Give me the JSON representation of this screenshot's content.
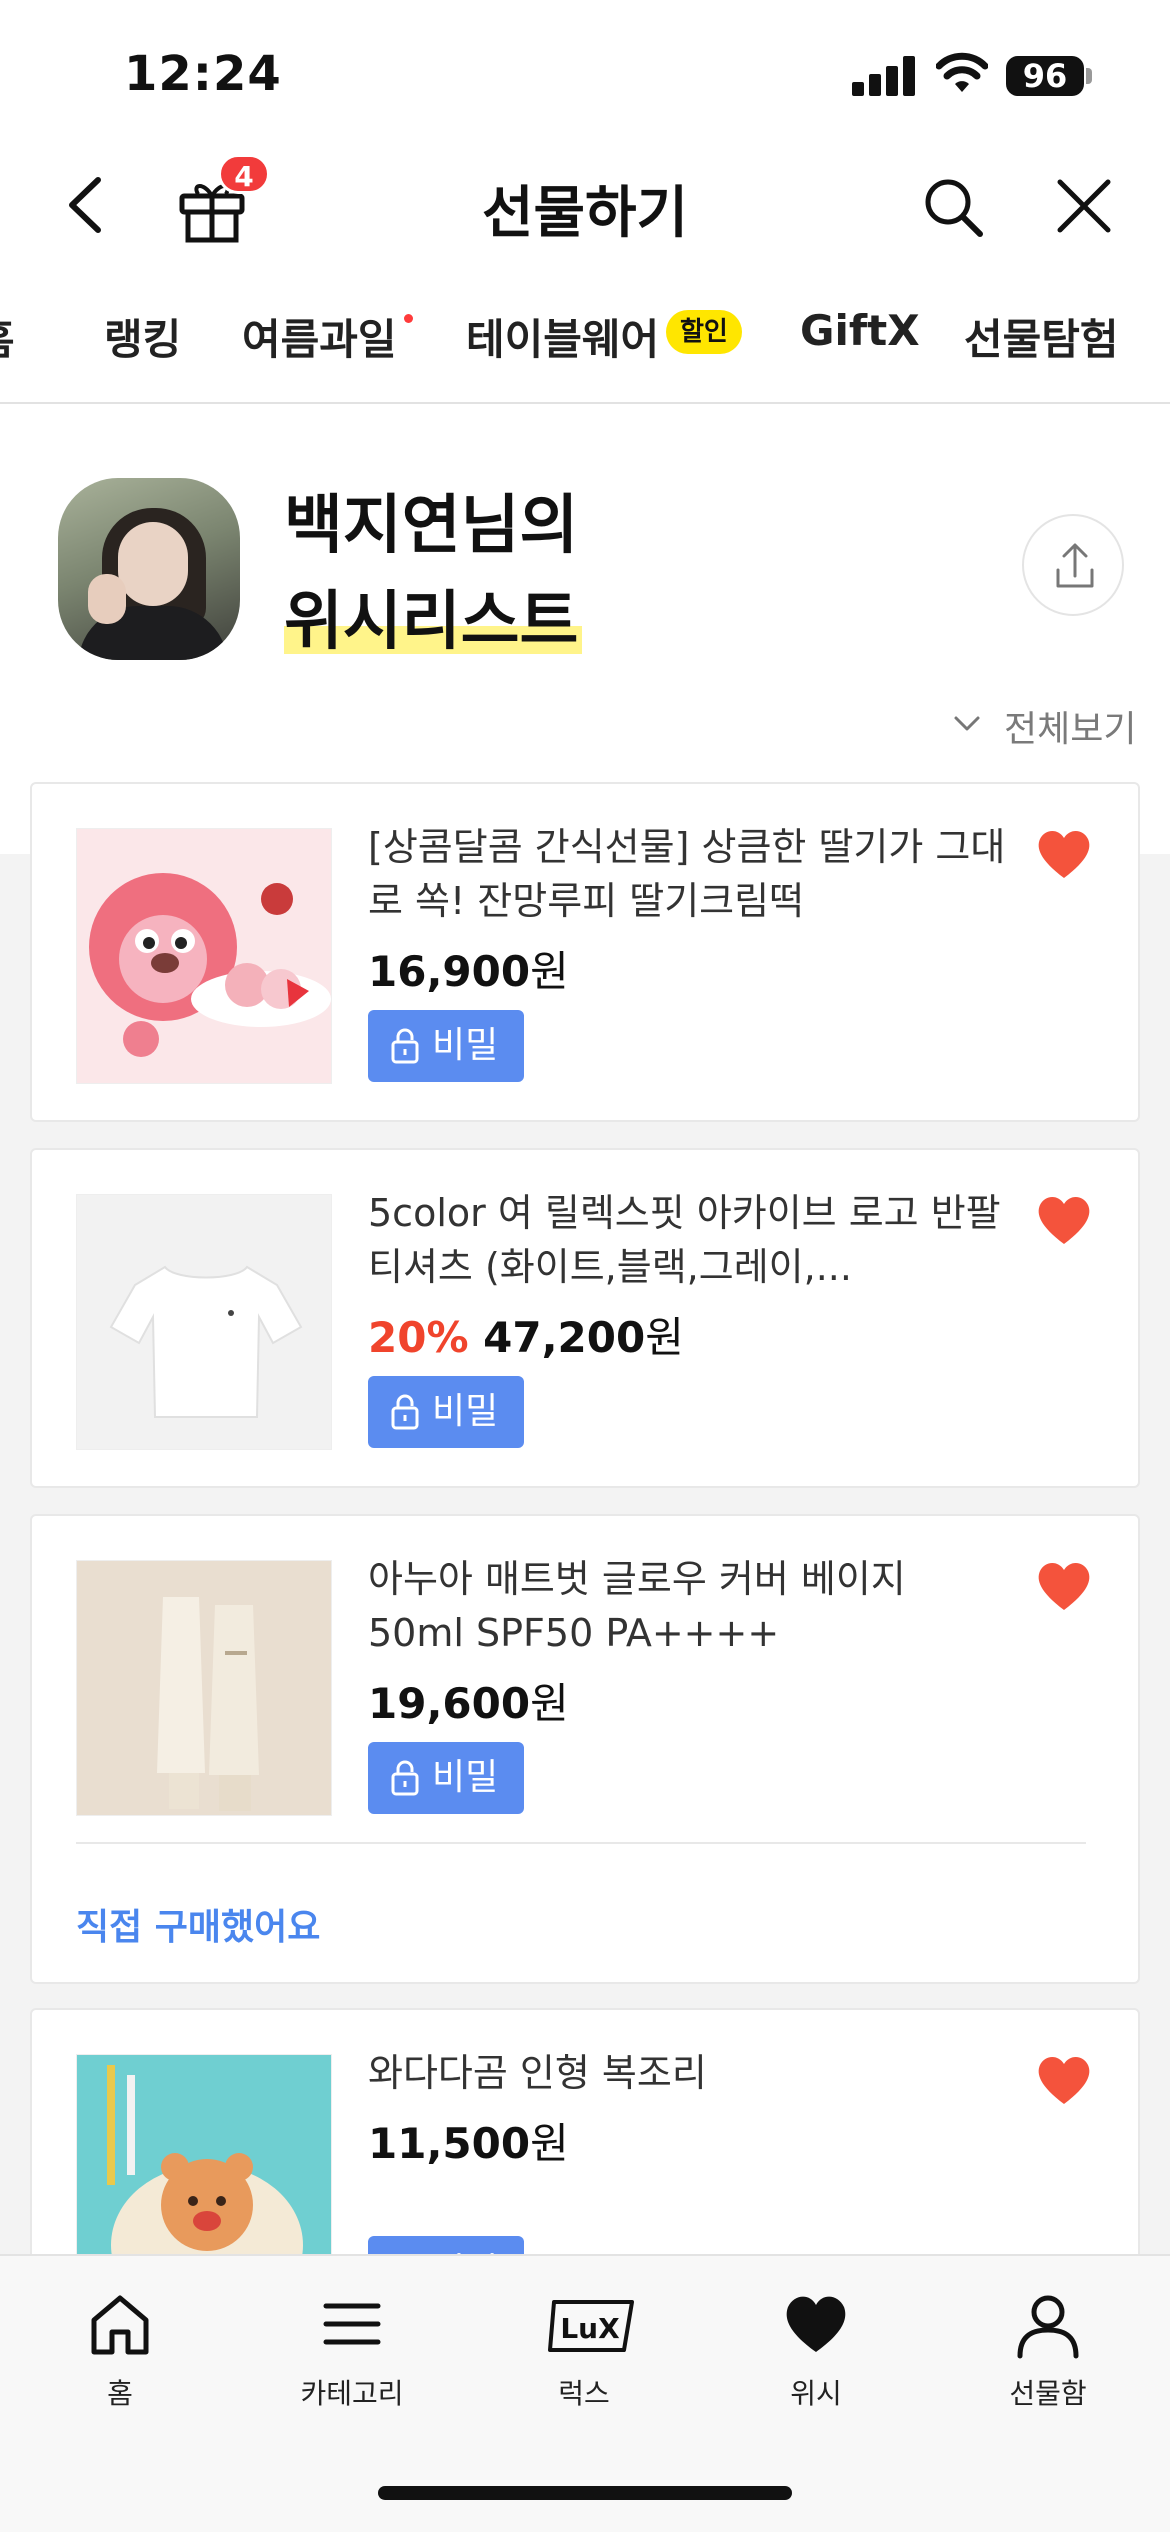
{
  "status_bar": {
    "time": "12:24",
    "battery": "96"
  },
  "header": {
    "title": "선물하기",
    "gift_badge_count": "4"
  },
  "tabs": [
    {
      "label": "홈"
    },
    {
      "label": "랭킹"
    },
    {
      "label": "여름과일",
      "dot": true
    },
    {
      "label": "테이블웨어",
      "badge": "할인"
    },
    {
      "label": "GiftX"
    },
    {
      "label": "선물탐험"
    }
  ],
  "profile": {
    "line1": "백지연님의",
    "line2": "위시리스트",
    "view_all": "전체보기"
  },
  "items": [
    {
      "title": "[상콤달콤 간식선물] 상큼한 딸기가 그대로 쏙! 잔망루피 딸기크림떡",
      "discount": "",
      "price": "16,900",
      "currency": "원",
      "secret_label": "비밀",
      "thumb_icon": "strawberry-rice-cake-product-image"
    },
    {
      "title": "5color 여 릴렉스핏 아카이브 로고 반팔 티셔츠 (화이트,블랙,그레이,...",
      "discount": "20%",
      "price": "47,200",
      "currency": "원",
      "secret_label": "비밀",
      "thumb_icon": "white-tshirt-product-image"
    },
    {
      "title": "아누아 매트벗 글로우 커버 베이지 50ml SPF50 PA++++",
      "discount": "",
      "price": "19,600",
      "currency": "원",
      "secret_label": "비밀",
      "bought_label": "직접 구매했어요",
      "thumb_icon": "sunscreen-tubes-product-image"
    },
    {
      "title": "와다다곰 인형 복조리",
      "discount": "",
      "price": "11,500",
      "currency": "원",
      "secret_label": "비밀",
      "thumb_icon": "bear-pouch-product-image"
    }
  ],
  "bottom_nav": [
    {
      "label": "홈",
      "icon": "home-icon"
    },
    {
      "label": "카테고리",
      "icon": "menu-icon"
    },
    {
      "label": "럭스",
      "icon": "lux-icon"
    },
    {
      "label": "위시",
      "icon": "heart-icon"
    },
    {
      "label": "선물함",
      "icon": "person-icon"
    }
  ],
  "colors": {
    "accent_blue": "#5b8cf0",
    "heart_red": "#f4533c",
    "discount_red": "#f0442c",
    "badge_yellow": "#ffe600",
    "highlight_yellow": "#fff48a"
  }
}
